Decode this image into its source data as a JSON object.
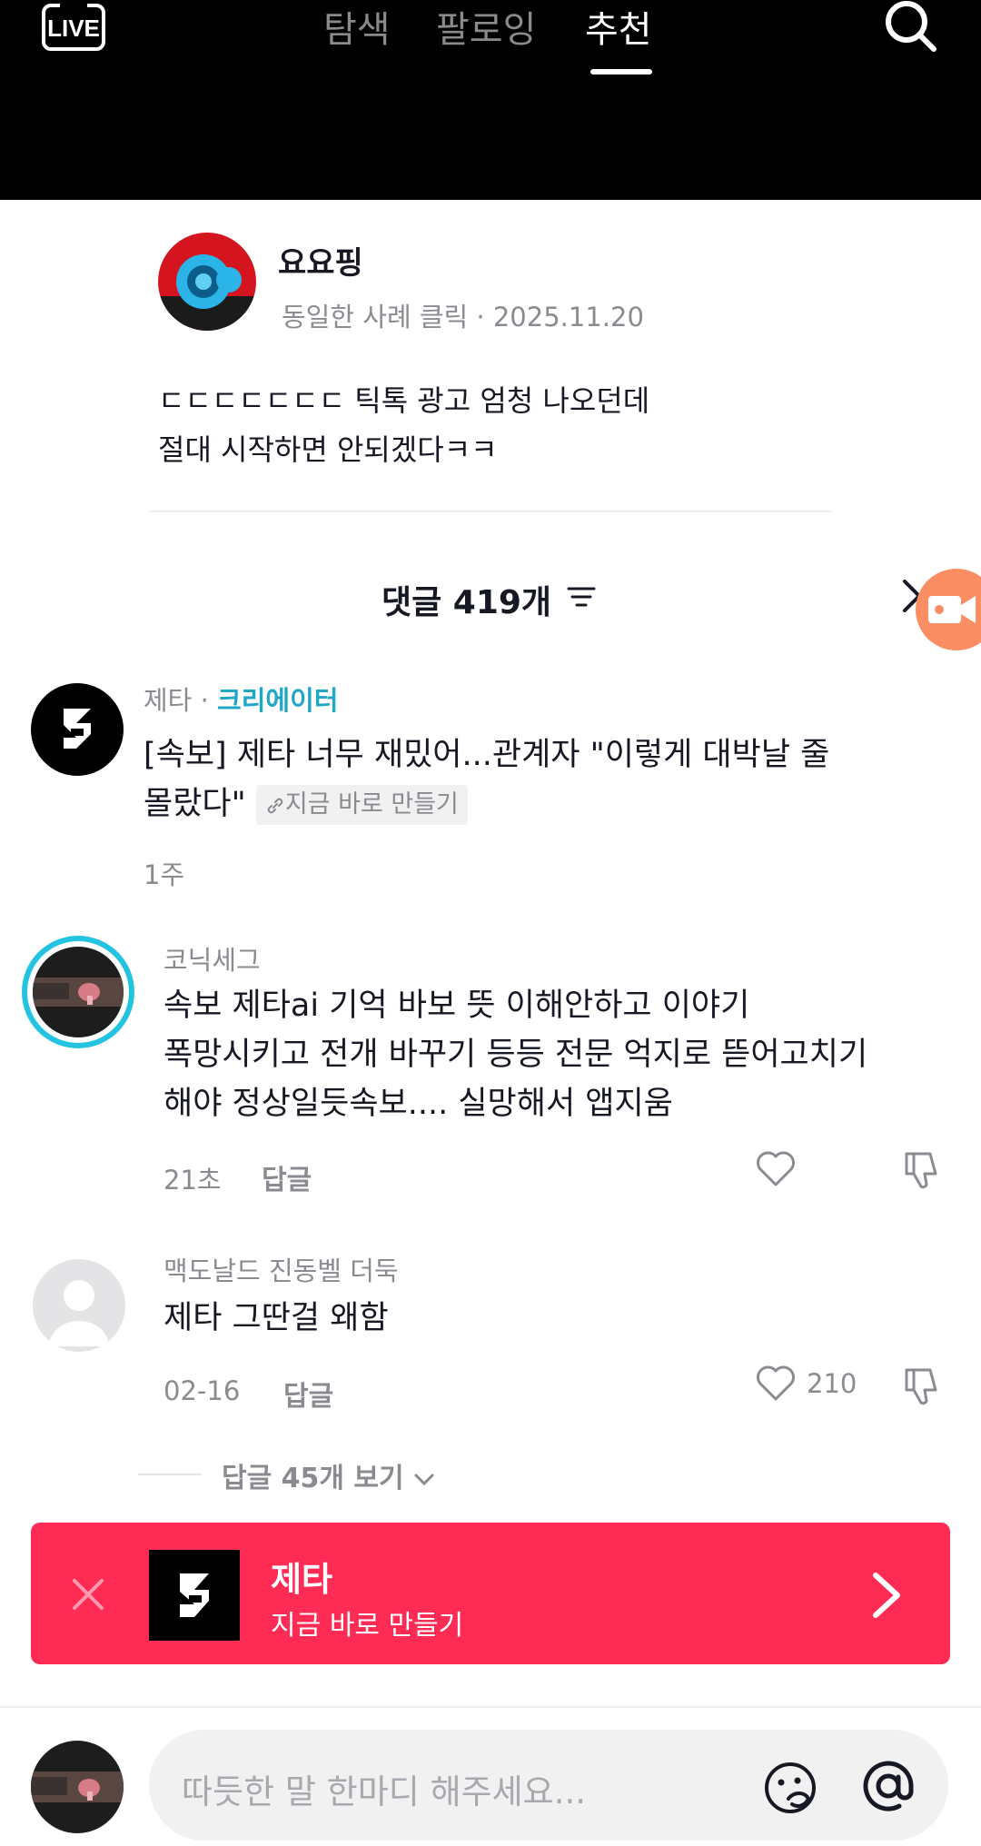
{
  "nav": {
    "live_label": "LIVE",
    "tabs": [
      {
        "label": "탐색"
      },
      {
        "label": "팔로잉"
      },
      {
        "label": "추천"
      }
    ],
    "active_tab": "추천"
  },
  "post": {
    "username": "요요핑",
    "meta": "동일한 사례 클릭 · 2025.11.20",
    "text_line1": "ㄷㄷㄷㄷㄷㄷㄷ 틱톡 광고 엄청 나오던데",
    "text_line2": "절대 시작하면 안되겠다ㅋㅋ"
  },
  "comments_header": {
    "title": "댓글 419개"
  },
  "comments": [
    {
      "username": "제타",
      "separator": " · ",
      "badge": "크리에이터",
      "text_line1": "[속보] 제타 너무 재밌어...관계자 \"이렇게 대박날 줄",
      "text_line2": "몰랐다\"",
      "link_label": "지금 바로 만들기",
      "time": "1주"
    },
    {
      "username": "코닉세그",
      "text_line1": "속보 제타ai 기억 바보 뜻 이해안하고 이야기",
      "text_line2": "폭망시키고 전개 바꾸기 등등 전문 억지로 뜯어고치기",
      "text_line3": "해야 정상일듯속보.... 실망해서 앱지움",
      "time": "21초",
      "reply_label": "답글"
    },
    {
      "username": "맥도날드 진동벨 더둑",
      "text_line1": "제타 그딴걸 왜함",
      "time": "02-16",
      "reply_label": "답글",
      "like_count": "210"
    }
  ],
  "view_replies": "답글 45개 보기",
  "banner": {
    "title": "제타",
    "subtitle": "지금 바로 만들기",
    "color": "#fe2c55"
  },
  "input": {
    "placeholder": "따듯한 말 한마디 해주세요..."
  },
  "colors": {
    "creator_badge": "#20a7c6",
    "float_button": "#fb8e63"
  }
}
